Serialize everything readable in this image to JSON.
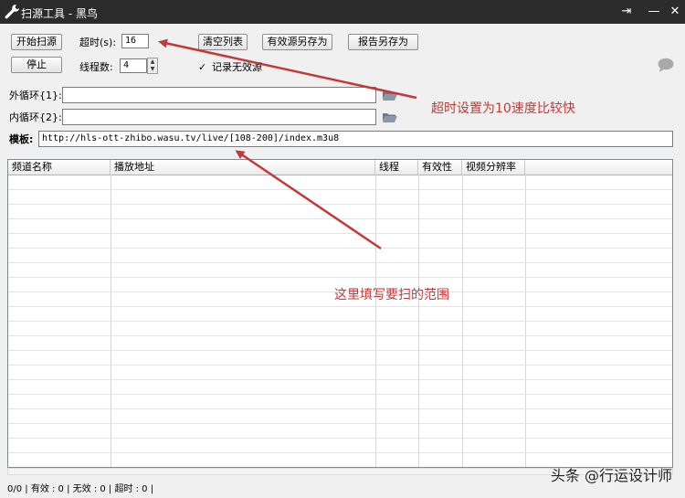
{
  "window": {
    "title": "扫源工具 - 黑鸟",
    "controls": {
      "restore": "⇥",
      "minimize": "—",
      "close": "✕"
    }
  },
  "toolbar": {
    "start_label": "开始扫源",
    "stop_label": "停止",
    "clear_label": "清空列表",
    "save_valid_label": "有效源另存为",
    "save_report_label": "报告另存为"
  },
  "settings": {
    "timeout_label": "超时(s):",
    "timeout_value": "16",
    "threads_label": "线程数:",
    "threads_value": "4",
    "record_invalid_label": "记录无效源",
    "record_invalid_checked": "✓"
  },
  "loops": {
    "outer_label": "外循环{1}:",
    "outer_value": "",
    "inner_label": "内循环{2}:",
    "inner_value": ""
  },
  "template": {
    "label": "模板:",
    "value": "http://hls-ott-zhibo.wasu.tv/live/[108-200]/index.m3u8"
  },
  "table": {
    "columns": [
      "频道名称",
      "播放地址",
      "线程",
      "有效性",
      "视频分辨率"
    ]
  },
  "status": {
    "text": "0/0  | 有效 : 0 | 无效 : 0 | 超时 : 0 |"
  },
  "annotations": {
    "timeout_note": "超时设置为10速度比较快",
    "range_note": "这里填写要扫的范围",
    "color": "#c43838"
  },
  "watermark": "头条 @行运设计师",
  "icons": {
    "title": "wrench-icon",
    "folder": "folder-icon",
    "chat": "chat-bubble-icon"
  }
}
